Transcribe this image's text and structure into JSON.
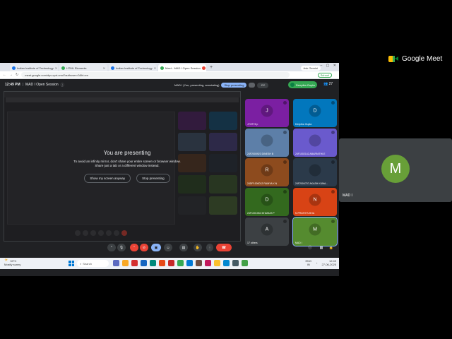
{
  "browser": {
    "tabs": [
      {
        "label": "Indian Institute of Technology",
        "active": false
      },
      {
        "label": "HTML Elements",
        "active": false
      },
      {
        "label": "Indian Institute of Technology",
        "active": false
      },
      {
        "label": "Meet - MAD I Open Session",
        "active": true
      }
    ],
    "new_tab": "+",
    "ask_gemini": "Ask Gemini",
    "window_controls": "– ▢ ✕",
    "url": "meet.google.com/dyv-cprt-xmd?authuser=0&hl=en",
    "school_badge": "School"
  },
  "meet": {
    "time": "12:49 PM",
    "separator": "|",
    "title": "MAD I Open Session",
    "presenting_text": "MAD I (You, presenting, annotating)",
    "stop_presenting": "Stop presenting",
    "cc_label": "CC",
    "user_chip": "Deepika Gupta",
    "people_count": "27",
    "overlay": {
      "heading": "You are presenting",
      "line1": "To avoid an infinity mirror, don't share your entire screen or browser window.",
      "line2": "Share just a tab or a different window instead.",
      "show_button": "Show my screen anyway",
      "stop_button": "Stop presenting"
    },
    "participants": [
      {
        "initial": "J",
        "name": "JYOTHI p",
        "color": "#7b1fa2"
      },
      {
        "initial": "D",
        "name": "Deepika Gupta",
        "color": "#0277bd"
      },
      {
        "initial": "",
        "name": "24F2000923 DINESH B",
        "color": "#5d7fa8"
      },
      {
        "initial": "",
        "name": "24F1002142 ABARNITHI.E",
        "color": "#6a5acd"
      },
      {
        "initial": "R",
        "name": "24DP1000012 RAMYA K N",
        "color": "#8d4b1e"
      },
      {
        "initial": "",
        "name": "24F2004707 AKASH KUMA...",
        "color": "#2b3a4a"
      },
      {
        "initial": "D",
        "name": "24F1001054 DHANUS P",
        "color": "#33691e"
      },
      {
        "initial": "N",
        "name": "N PRATHYUSHA",
        "color": "#d84315"
      },
      {
        "initial": "A",
        "name": "17 others",
        "color": "#3c4043"
      },
      {
        "initial": "M",
        "name": "MAD I",
        "color": "#558b2f"
      }
    ]
  },
  "taskbar": {
    "temperature": "33°C",
    "weather": "Mostly sunny",
    "search": "Search",
    "lang": "ENG",
    "region": "IN",
    "clock_time": "12:49",
    "clock_date": "27-06-2025"
  },
  "side": {
    "logo_text": "Google Meet",
    "self_initial": "M",
    "self_name": "MAD I"
  }
}
